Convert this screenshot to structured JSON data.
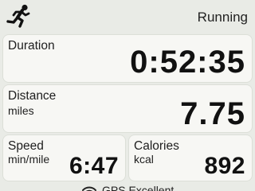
{
  "header": {
    "activity_icon": "runner-icon",
    "activity": "Running"
  },
  "stats": {
    "duration": {
      "label": "Duration",
      "value": "0:52:35"
    },
    "distance": {
      "label": "Distance",
      "unit": "miles",
      "value": "7.75"
    },
    "speed": {
      "label": "Speed",
      "unit": "min/mile",
      "value": "6:47"
    },
    "calories": {
      "label": "Calories",
      "unit": "kcal",
      "value": "892"
    }
  },
  "footer": {
    "gps_icon": "gps-signal-icon",
    "gps_status": "GPS Excellent"
  }
}
